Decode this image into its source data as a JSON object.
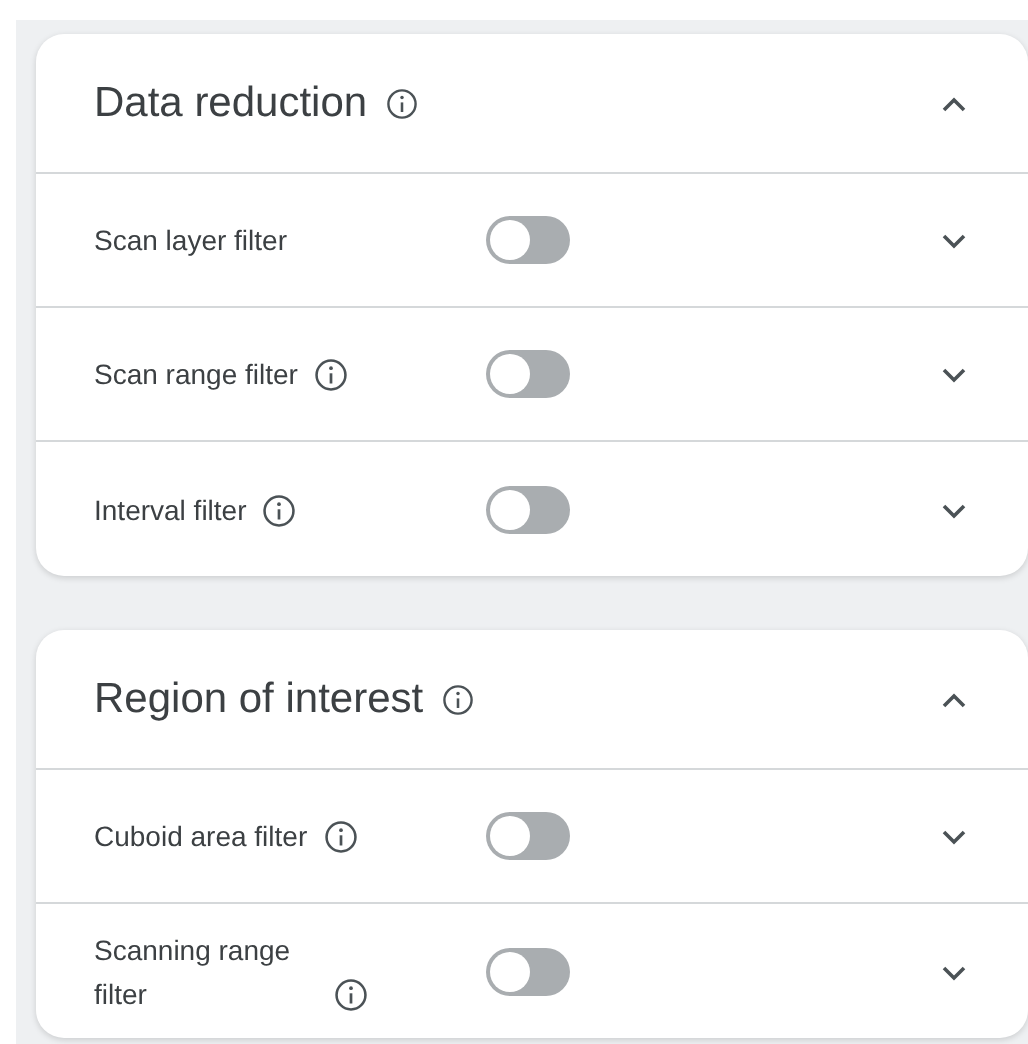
{
  "sections": [
    {
      "title": "Data reduction",
      "info": true,
      "expanded": true,
      "filters": [
        {
          "label": "Scan layer filter",
          "info": false,
          "on": false
        },
        {
          "label": "Scan range filter",
          "info": true,
          "on": false
        },
        {
          "label": "Interval filter",
          "info": true,
          "on": false
        }
      ]
    },
    {
      "title": "Region of interest",
      "info": true,
      "expanded": true,
      "filters": [
        {
          "label": "Cuboid area filter",
          "info": true,
          "on": false
        },
        {
          "label": "Scanning range filter",
          "info": true,
          "on": false
        }
      ]
    }
  ]
}
